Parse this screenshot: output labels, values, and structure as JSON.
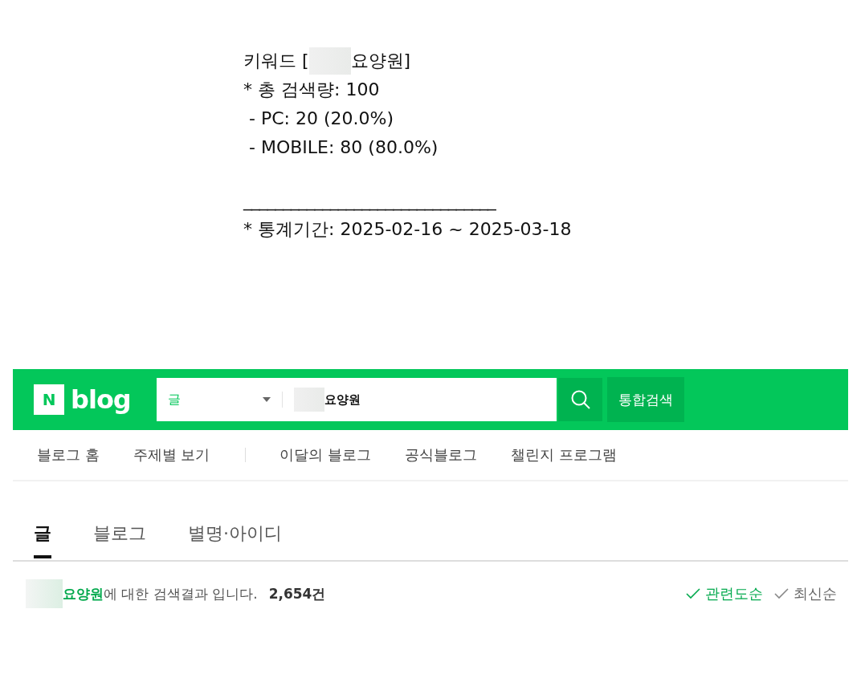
{
  "memo": {
    "keyword_line": {
      "prefix": "키워드 [",
      "suffix": "요양원]"
    },
    "lines": [
      "* 총 검색량: 100",
      " - PC: 20 (20.0%)",
      " - MOBILE: 80 (80.0%)"
    ],
    "rule": "________________________________",
    "period": "* 통계기간: 2025-02-16 ~ 2025-03-18"
  },
  "header": {
    "logo_mark": "N",
    "logo_text": "blog",
    "search_scope": "글",
    "search_value": "요양원",
    "total_search_button": "통합검색"
  },
  "nav": [
    {
      "label": "블로그 홈",
      "kind": "link"
    },
    {
      "label": "주제별 보기",
      "kind": "link"
    },
    {
      "kind": "divider"
    },
    {
      "label": "이달의 블로그",
      "kind": "link"
    },
    {
      "label": "공식블로그",
      "kind": "link"
    },
    {
      "label": "챌린지 프로그램",
      "kind": "link"
    }
  ],
  "tabs": [
    {
      "label": "글",
      "selected": true
    },
    {
      "label": "블로그",
      "selected": false
    },
    {
      "label": "별명·아이디",
      "selected": false
    }
  ],
  "result": {
    "summary": "**요양원**에 대한 검색결과 입니다.",
    "count": "2,654건",
    "sort": [
      {
        "label": "관련도순",
        "selected": true
      },
      {
        "label": "최신순",
        "selected": false
      }
    ]
  }
}
